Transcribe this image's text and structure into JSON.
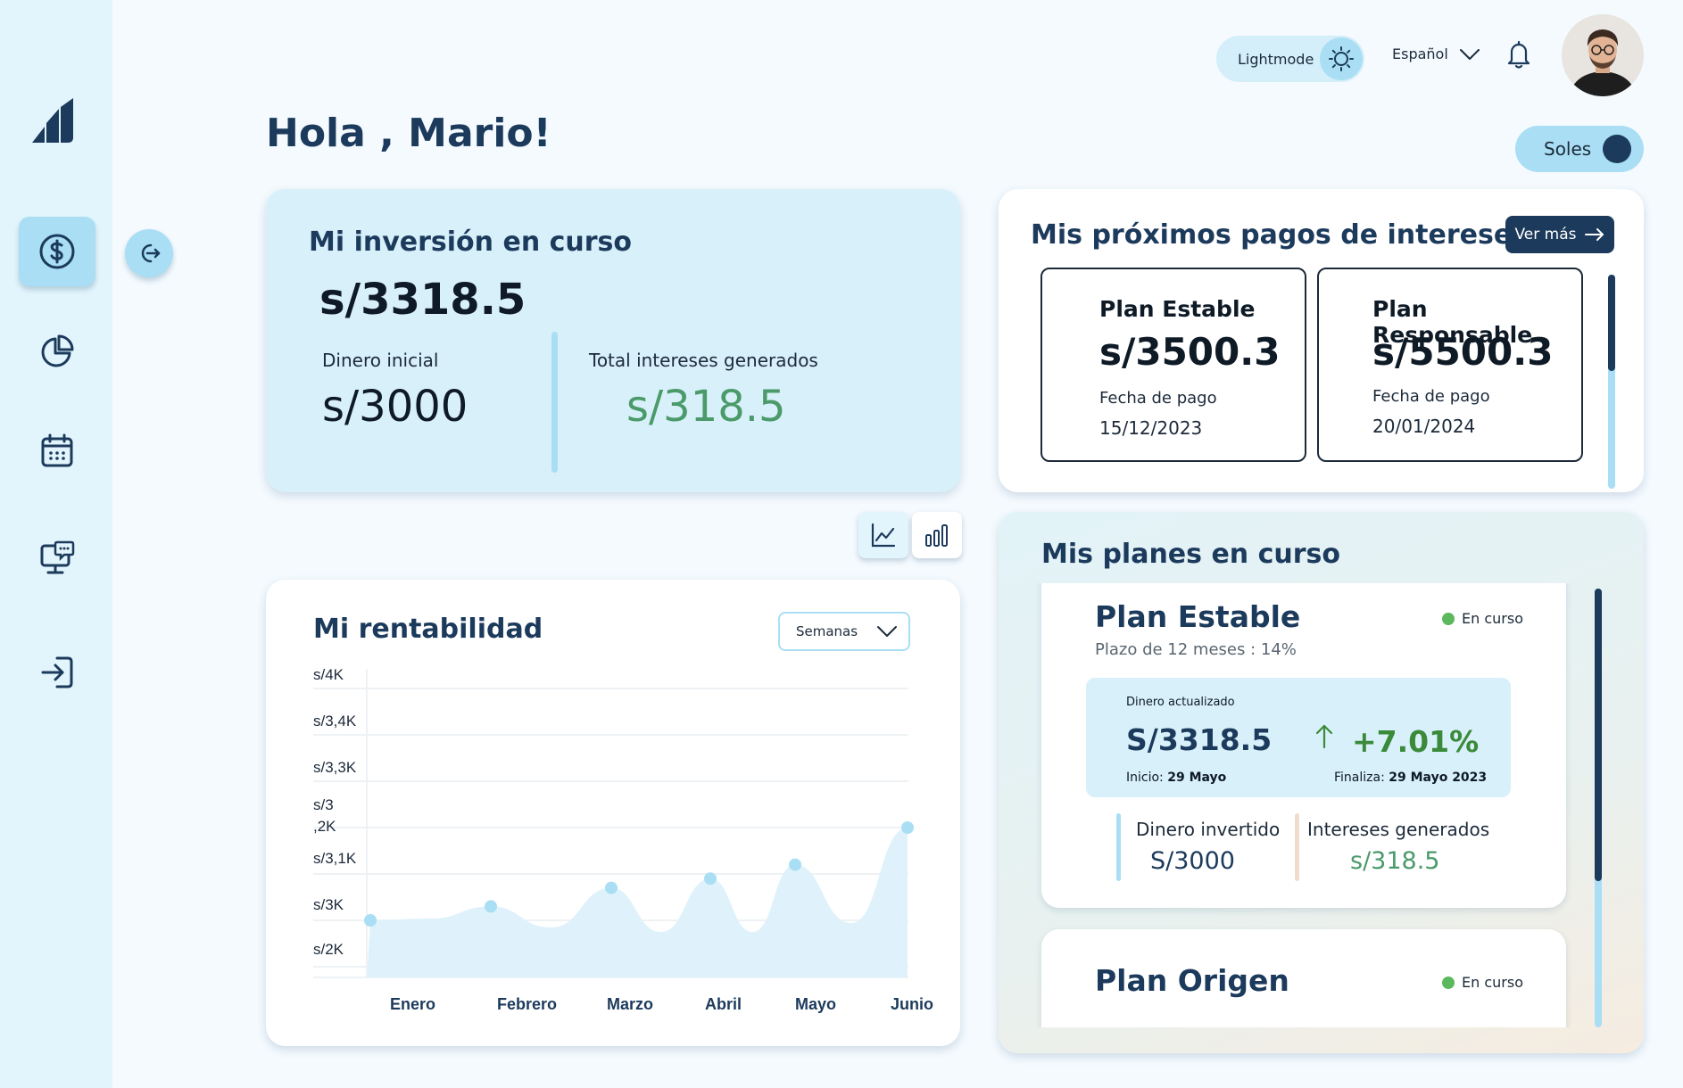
{
  "header": {
    "mode_label": "Lightmode",
    "language": "Español",
    "greeting": "Hola , Mario!",
    "currency": "Soles"
  },
  "sidebar": {
    "items": [
      {
        "name": "dollar-icon",
        "active": true
      },
      {
        "name": "pie-chart-icon",
        "active": false
      },
      {
        "name": "calendar-icon",
        "active": false
      },
      {
        "name": "support-chat-icon",
        "active": false
      },
      {
        "name": "login-icon",
        "active": false
      }
    ]
  },
  "investment": {
    "title": "Mi inversión en curso",
    "total": "s/3318.5",
    "initial_label": "Dinero inicial",
    "initial_value": "s/3000",
    "interest_label": "Total intereses generados",
    "interest_value": "s/318.5"
  },
  "payments": {
    "title": "Mis próximos pagos de intereses",
    "more_label": "Ver más",
    "plans": [
      {
        "name": "Plan Estable",
        "amount": "s/3500.3",
        "date_label": "Fecha de pago",
        "date": "15/12/2023"
      },
      {
        "name": "Plan Responsable",
        "amount": "s/5500.3",
        "date_label": "Fecha de pago",
        "date": "20/01/2024"
      }
    ]
  },
  "rentabilidad": {
    "title": "Mi rentabilidad",
    "period": "Semanas"
  },
  "chart_data": {
    "type": "area",
    "title": "Mi rentabilidad",
    "xlabel": "",
    "ylabel": "",
    "categories": [
      "Enero",
      "Febrero",
      "Marzo",
      "Abril",
      "Mayo",
      "Junio"
    ],
    "ytick_labels": [
      "s/4K",
      "s/3,4K",
      "s/3,3K",
      "s/3 ,2K",
      "s/3,1K",
      "s/3K",
      "s/2K"
    ],
    "ytick_values": [
      4000,
      3400,
      3300,
      3200,
      3100,
      3000,
      2000
    ],
    "series": [
      {
        "x": [
          "Enero",
          "Febrero",
          "Marzo",
          "Abril",
          "Mayo",
          "Junio"
        ],
        "values": [
          3000,
          3030,
          3070,
          3090,
          3120,
          3200
        ]
      }
    ],
    "color": "#a9def4",
    "grid": true
  },
  "plans": {
    "title": "Mis planes en curso",
    "items": [
      {
        "name": "Plan Estable",
        "term": "Plazo de 12 meses : 14%",
        "status": "En curso",
        "updated_label": "Dinero actualizado",
        "updated_value": "S/3318.5",
        "change": "+7.01%",
        "start_label": "Inicio:",
        "start": "29 Mayo",
        "end_label": "Finaliza:",
        "end": "29 Mayo 2023",
        "invested_label": "Dinero invertido",
        "invested_value": "S/3000",
        "interest_label": "Intereses generados",
        "interest_value": "s/318.5"
      },
      {
        "name": "Plan Origen",
        "status": "En curso"
      }
    ]
  }
}
